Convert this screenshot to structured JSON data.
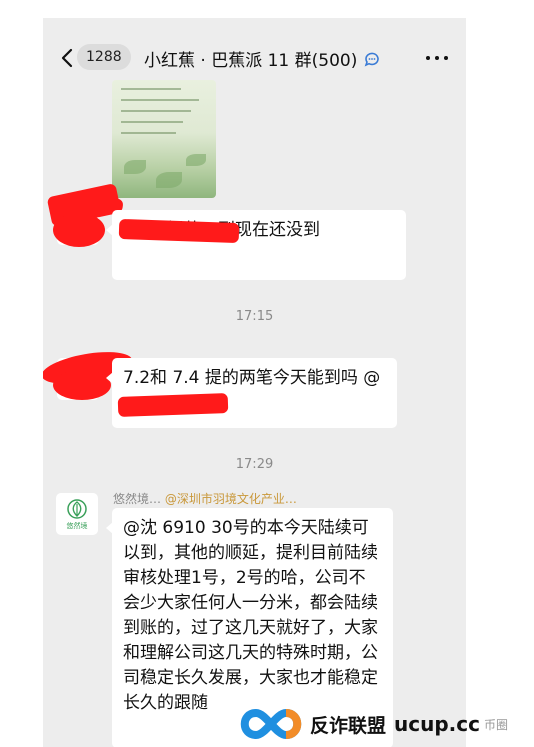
{
  "nav": {
    "unread_count": "1288",
    "title": "小红蕉 · 巴蕉派 11 群(500)",
    "title_icon": "chat-bubble-icon",
    "more_icon": "more-icon"
  },
  "messages": [
    {
      "type": "image",
      "sender": "redacted"
    },
    {
      "type": "text",
      "text": "7.1日提的，到现在还没到"
    },
    {
      "type": "time",
      "text": "17:15"
    },
    {
      "type": "text",
      "text": "7.2和 7.4 提的两笔今天能到吗 @"
    },
    {
      "type": "time",
      "text": "17:29"
    },
    {
      "type": "text",
      "sender_name": "悠然境…",
      "sender_org": "@深圳市羽境文化产业…",
      "avatar_label": "悠然境",
      "text": "@沈 6910 30号的本今天陆续可以到，其他的顺延，提利目前陆续审核处理1号，2号的哈，公司不会少大家任何人一分米，都会陆续到账的，过了这几天就好了，大家和理解公司这几天的特殊时期，公司稳定长久发展，大家也才能稳定长久的跟随"
    }
  ],
  "watermark": {
    "brand": "反诈联盟",
    "url": "ucup.cc",
    "faint": "币圈"
  },
  "colors": {
    "chat_bg": "#ededed",
    "bubble": "#ffffff",
    "redaction": "#ff1a1a",
    "org_text": "#c9983a"
  }
}
